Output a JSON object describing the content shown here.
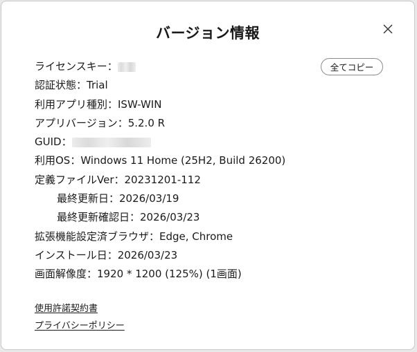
{
  "dialog": {
    "title": "バージョン情報",
    "close_icon": "close-icon",
    "copy_all_label": "全てコピー"
  },
  "info": {
    "license_key_label": "ライセンスキー：",
    "auth_status": "認証状態：Trial",
    "app_type": "利用アプリ種別：ISW-WIN",
    "app_version": "アプリバージョン：5.2.0 R",
    "guid_label": "GUID：",
    "os": "利用OS：Windows 11 Home (25H2, Build 26200)",
    "definition_file": "定義ファイルVer：20231201-112",
    "last_update": "最終更新日：2026/03/19",
    "last_update_check": "最終更新確認日：2026/03/23",
    "browser_ext": "拡張機能設定済ブラウザ：Edge, Chrome",
    "install_date": "インストール日：2026/03/23",
    "resolution": "画面解像度：1920 * 1200 (125%) (1画面)"
  },
  "links": {
    "license_agreement": "使用許諾契約書",
    "privacy_policy": "プライバシーポリシー"
  }
}
